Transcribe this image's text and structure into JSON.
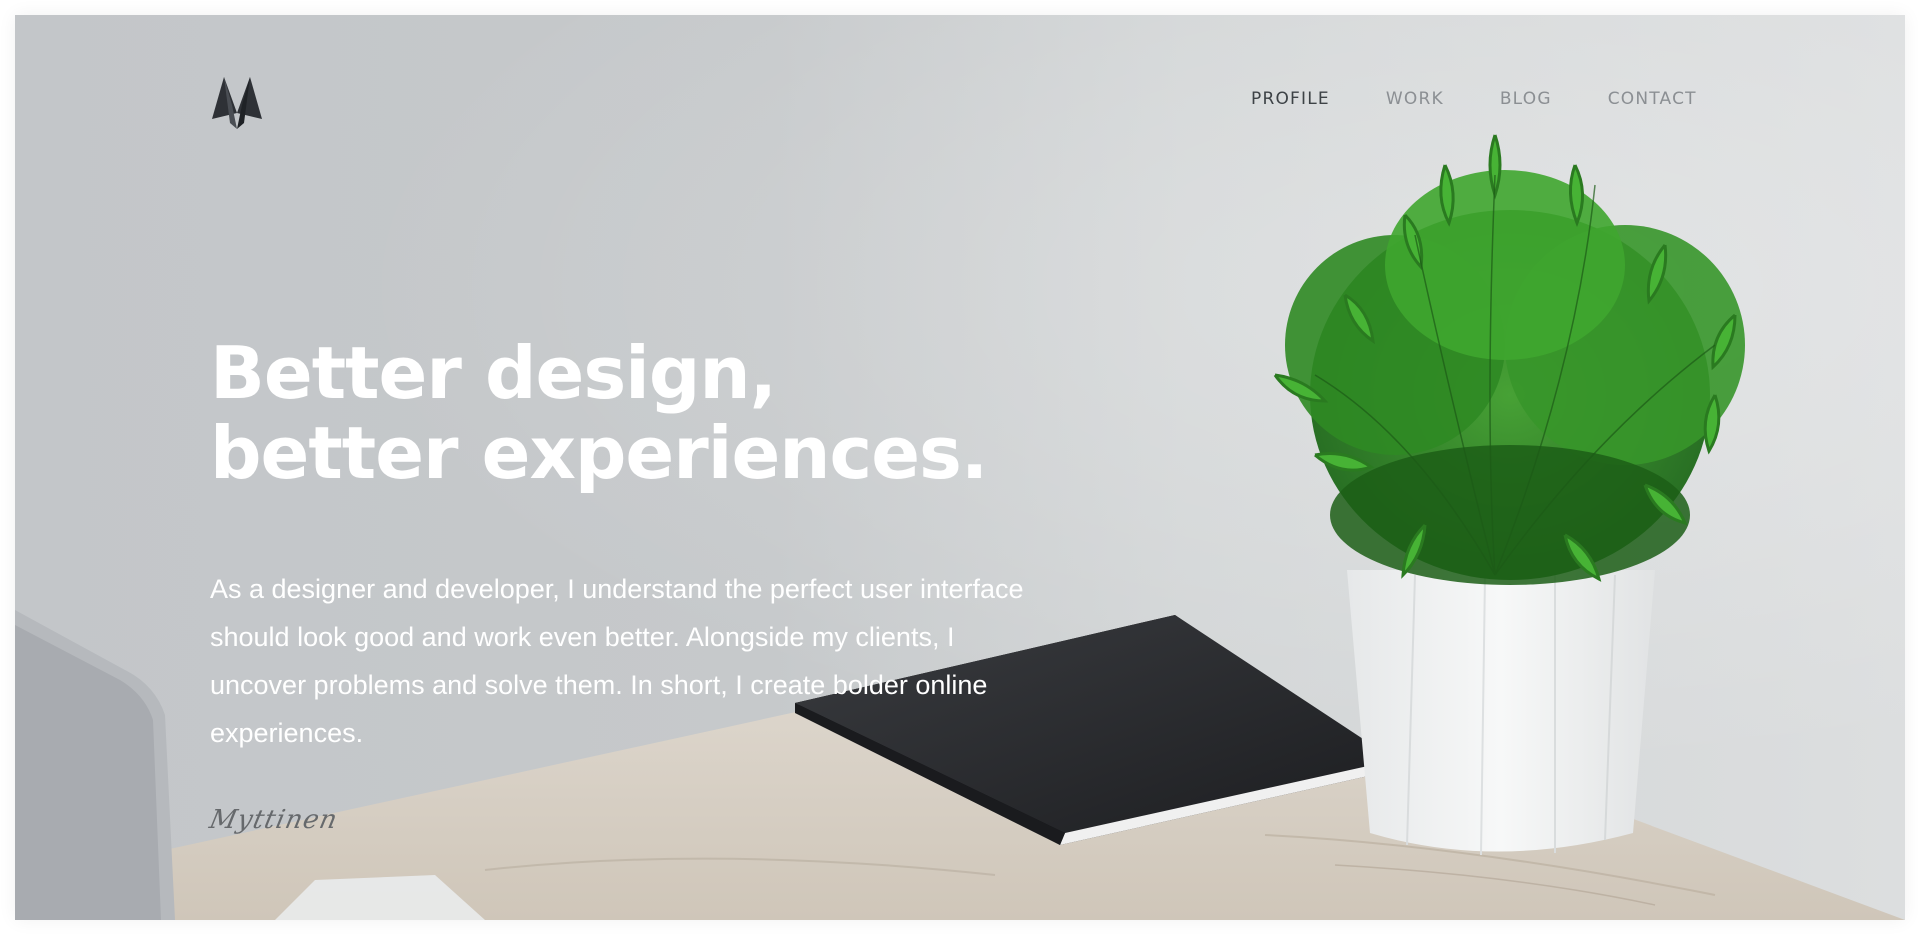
{
  "nav": {
    "items": [
      {
        "label": "PROFILE",
        "active": true
      },
      {
        "label": "WORK",
        "active": false
      },
      {
        "label": "BLOG",
        "active": false
      },
      {
        "label": "CONTACT",
        "active": false
      }
    ]
  },
  "hero": {
    "headline_line1": "Better design,",
    "headline_line2": "better experiences.",
    "bio": "As a designer and developer, I understand the perfect user interface should look good and work even better. Alongside my clients, I uncover problems and solve them. In short, I create bolder online experiences.",
    "signature": "Myttinen"
  },
  "colors": {
    "nav_active": "#3d4246",
    "nav_inactive": "#8b8f93",
    "headline": "#ffffff",
    "wall": "#c6c9cb",
    "logo": "#2e3136"
  },
  "icons": {
    "logo": "brand-m-logo"
  }
}
